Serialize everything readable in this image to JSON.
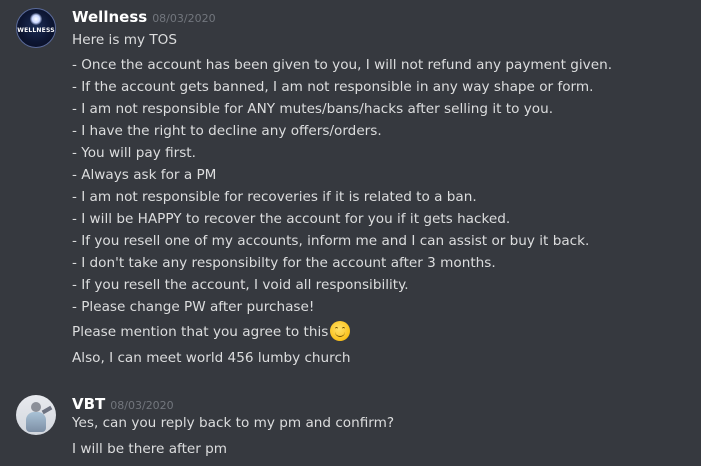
{
  "messages": [
    {
      "author": "Wellness",
      "date": "08/03/2020",
      "avatar_icon": "wellness-logo",
      "avatar_text": "WELLNESS",
      "lines": [
        "Here is my TOS",
        "- Once the account has been given to you, I will not refund any payment given.",
        "- If the account gets banned, I am not responsible in any way shape or form.",
        "- I am not responsible for ANY mutes/bans/hacks after selling it to you.",
        "- I have the right to decline any offers/orders.",
        "- You will pay first.",
        "- Always ask for a PM",
        "- I am not responsible for recoveries if it is related to a ban.",
        "- I will be HAPPY to recover the account for you if it gets hacked.",
        "- If you resell one of my accounts, inform me and I can assist or buy it back.",
        "- I don't take any responsibilty for the account after 3 months.",
        "- If you resell the account, I void all responsibility.",
        "- Please change PW after purchase!"
      ],
      "followups": [
        {
          "text": "Please mention that you agree to this",
          "emoji": "slightly-smiling-face-icon"
        },
        {
          "text": "Also, I can meet world 456 lumby church"
        }
      ]
    },
    {
      "author": "VBT",
      "date": "08/03/2020",
      "avatar_icon": "vbt-avatar",
      "followups": [
        {
          "text": "Yes, can you reply back to my pm and confirm?"
        },
        {
          "text": "I will be there after pm"
        }
      ]
    }
  ],
  "colors": {
    "background": "#36393f",
    "username": "#ffffff",
    "timestamp": "#72767d",
    "text": "#dcddde"
  }
}
